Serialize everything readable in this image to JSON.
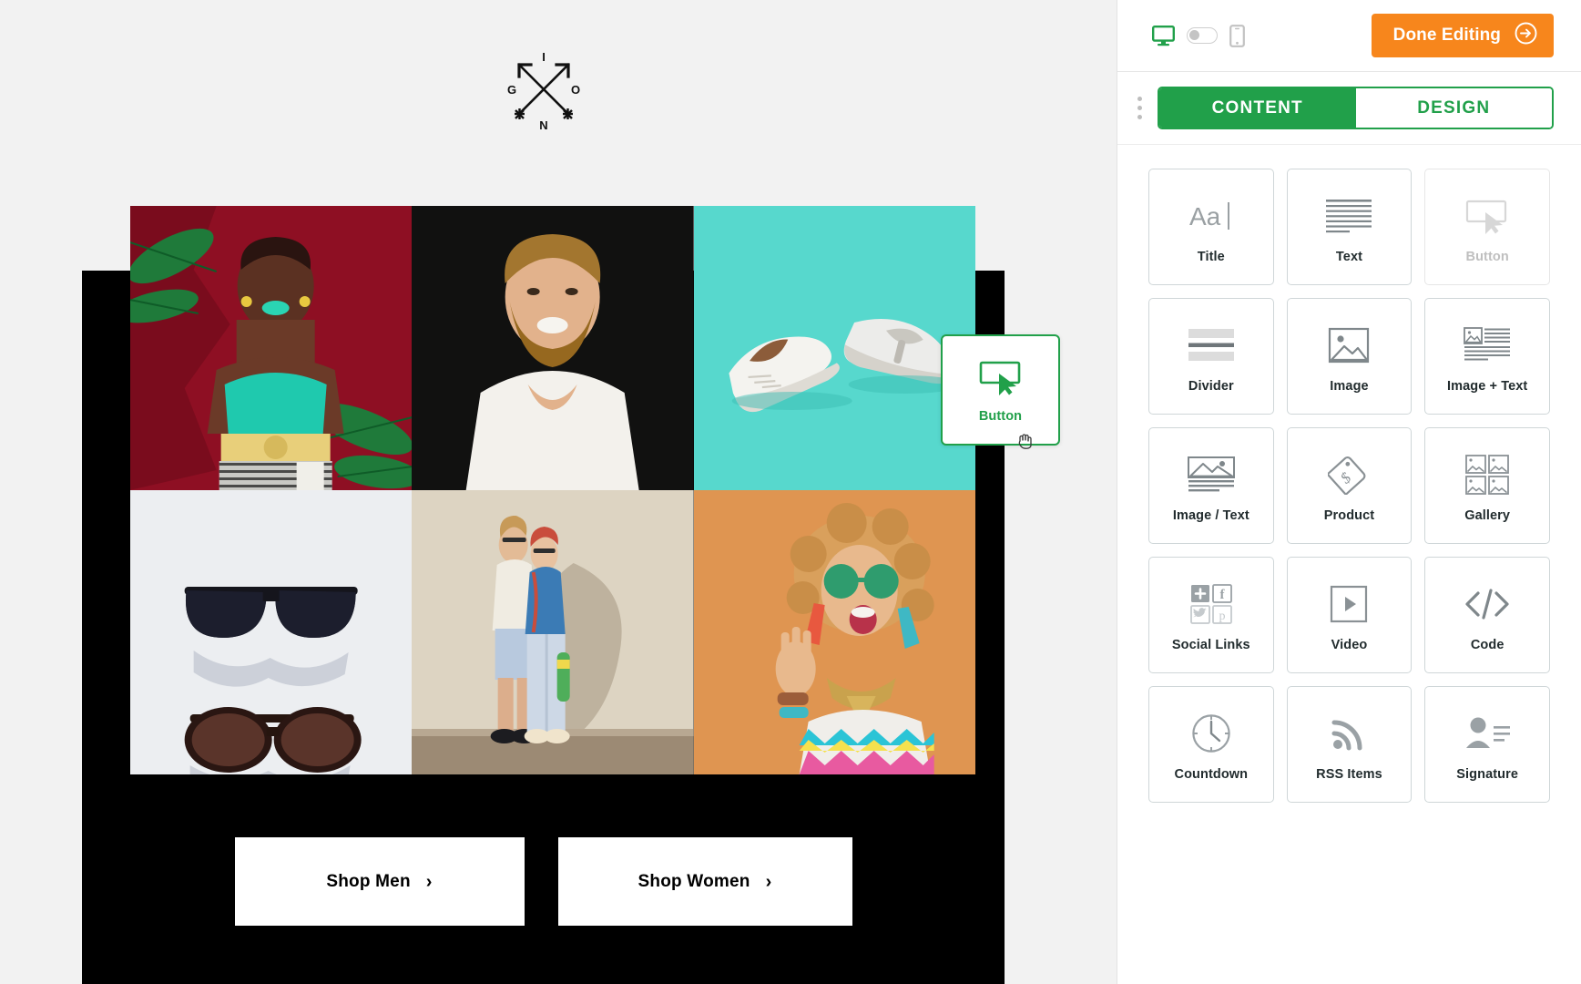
{
  "editor": {
    "topbar": {
      "desktop_icon": "desktop-monitor-icon",
      "toggle_state": "off",
      "mobile_icon": "mobile-phone-icon",
      "done_label": "Done Editing",
      "done_icon": "arrow-right-circle-icon",
      "done_color": "#f7861c"
    },
    "tabs": [
      {
        "label": "CONTENT",
        "active": true
      },
      {
        "label": "DESIGN",
        "active": false
      }
    ],
    "accent_color": "#21a04a",
    "blocks": [
      {
        "label": "Title",
        "icon": "title-aa-icon",
        "dimmed": false
      },
      {
        "label": "Text",
        "icon": "text-lines-icon",
        "dimmed": false
      },
      {
        "label": "Button",
        "icon": "button-cursor-icon",
        "dimmed": true
      },
      {
        "label": "Divider",
        "icon": "divider-icon",
        "dimmed": false
      },
      {
        "label": "Image",
        "icon": "image-picture-icon",
        "dimmed": false
      },
      {
        "label": "Image + Text",
        "icon": "image-text-icon",
        "dimmed": false
      },
      {
        "label": "Image / Text",
        "icon": "image-over-text-icon",
        "dimmed": false
      },
      {
        "label": "Product",
        "icon": "price-tag-icon",
        "dimmed": false
      },
      {
        "label": "Gallery",
        "icon": "gallery-grid-icon",
        "dimmed": false
      },
      {
        "label": "Social Links",
        "icon": "social-links-icon",
        "dimmed": false
      },
      {
        "label": "Video",
        "icon": "video-play-icon",
        "dimmed": false
      },
      {
        "label": "Code",
        "icon": "code-brackets-icon",
        "dimmed": false
      },
      {
        "label": "Countdown",
        "icon": "clock-icon",
        "dimmed": false
      },
      {
        "label": "RSS Items",
        "icon": "rss-icon",
        "dimmed": false
      },
      {
        "label": "Signature",
        "icon": "signature-person-icon",
        "dimmed": false
      }
    ],
    "drag_ghost": {
      "label": "Button",
      "icon": "button-cursor-icon",
      "cursor": "grabbing-hand-cursor"
    }
  },
  "email": {
    "logo": {
      "name": "gion-compass-logo",
      "letters": {
        "top": "I",
        "left": "G",
        "right": "O",
        "bottom": "N"
      }
    },
    "image_grid": [
      {
        "name": "woman-red-background-photo",
        "alt": "Woman with green lipstick and teal top against red background with palm leaves"
      },
      {
        "name": "bearded-man-black-background-photo",
        "alt": "Smiling bearded man in white t-shirt on black background"
      },
      {
        "name": "white-sneakers-teal-photo",
        "alt": "Two white sneakers on teal background"
      },
      {
        "name": "sunglasses-flatlay-photo",
        "alt": "Two pairs of sunglasses on white surface"
      },
      {
        "name": "couple-wall-street-photo",
        "alt": "Two people leaning on a beige wall with skateboard"
      },
      {
        "name": "woman-orange-background-photo",
        "alt": "Laughing woman with green sunglasses on orange background"
      }
    ],
    "cta_buttons": [
      {
        "label": "Shop Men",
        "chevron": "chevron-right-icon"
      },
      {
        "label": "Shop Women",
        "chevron": "chevron-right-icon"
      }
    ],
    "background_color": "#000000",
    "header_background": "#f2f2f2"
  }
}
